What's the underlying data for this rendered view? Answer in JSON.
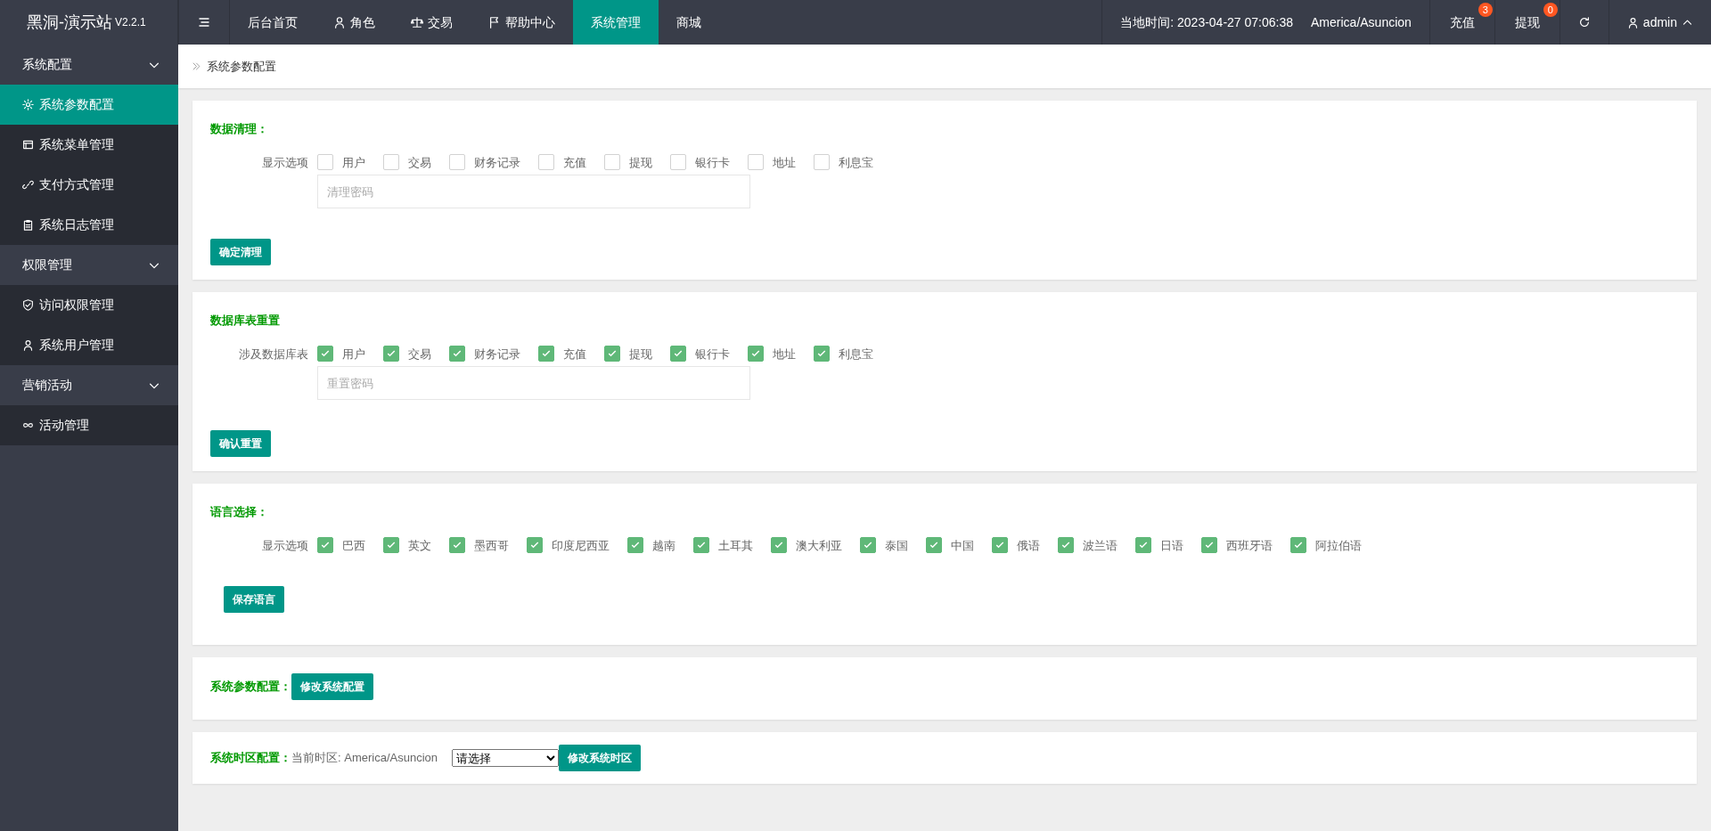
{
  "brand": {
    "name": "黑洞-演示站",
    "version": "V2.2.1"
  },
  "top_nav": [
    {
      "label": "后台首页",
      "selected": false
    },
    {
      "label": "角色",
      "selected": false
    },
    {
      "label": "交易",
      "selected": false
    },
    {
      "label": "帮助中心",
      "selected": false
    },
    {
      "label": "系统管理",
      "selected": true
    },
    {
      "label": "商城",
      "selected": false
    }
  ],
  "top_right": {
    "time": "当地时间: 2023-04-27 07:06:38",
    "timezone": "America/Asuncion",
    "actions": [
      {
        "label": "充值",
        "badge": "3"
      },
      {
        "label": "提现",
        "badge": "0"
      }
    ],
    "user": "admin"
  },
  "sidebar": [
    {
      "label": "系统配置",
      "expanded": true,
      "items": [
        {
          "label": "系统参数配置",
          "selected": true
        },
        {
          "label": "系统菜单管理",
          "selected": false
        },
        {
          "label": "支付方式管理",
          "selected": false
        },
        {
          "label": "系统日志管理",
          "selected": false
        }
      ]
    },
    {
      "label": "权限管理",
      "expanded": true,
      "items": [
        {
          "label": "访问权限管理",
          "selected": false
        },
        {
          "label": "系统用户管理",
          "selected": false
        }
      ]
    },
    {
      "label": "营销活动",
      "expanded": true,
      "items": [
        {
          "label": "活动管理",
          "selected": false
        }
      ]
    }
  ],
  "breadcrumb": "系统参数配置",
  "sections": [
    {
      "kind": "checks",
      "title": "数据清理：",
      "field_label": "显示选项",
      "options": [
        {
          "label": "用户",
          "checked": false
        },
        {
          "label": "交易",
          "checked": false
        },
        {
          "label": "财务记录",
          "checked": false
        },
        {
          "label": "充值",
          "checked": false
        },
        {
          "label": "提现",
          "checked": false
        },
        {
          "label": "银行卡",
          "checked": false
        },
        {
          "label": "地址",
          "checked": false
        },
        {
          "label": "利息宝",
          "checked": false
        }
      ],
      "placeholder": "清理密码",
      "button": "确定清理"
    },
    {
      "kind": "checks",
      "title": "数据库表重置",
      "field_label": "涉及数据库表",
      "options": [
        {
          "label": "用户",
          "checked": true
        },
        {
          "label": "交易",
          "checked": true
        },
        {
          "label": "财务记录",
          "checked": true
        },
        {
          "label": "充值",
          "checked": true
        },
        {
          "label": "提现",
          "checked": true
        },
        {
          "label": "银行卡",
          "checked": true
        },
        {
          "label": "地址",
          "checked": true
        },
        {
          "label": "利息宝",
          "checked": true
        }
      ],
      "placeholder": "重置密码",
      "button": "确认重置"
    },
    {
      "kind": "checks",
      "title": "语言选择：",
      "field_label": "显示选项",
      "options": [
        {
          "label": "巴西",
          "checked": true
        },
        {
          "label": "英文",
          "checked": true
        },
        {
          "label": "墨西哥",
          "checked": true
        },
        {
          "label": "印度尼西亚",
          "checked": true
        },
        {
          "label": "越南",
          "checked": true
        },
        {
          "label": "土耳其",
          "checked": true
        },
        {
          "label": "澳大利亚",
          "checked": true
        },
        {
          "label": "泰国",
          "checked": true
        },
        {
          "label": "中国",
          "checked": true
        },
        {
          "label": "俄语",
          "checked": true
        },
        {
          "label": "波兰语",
          "checked": true
        },
        {
          "label": "日语",
          "checked": true
        },
        {
          "label": "西班牙语",
          "checked": true
        },
        {
          "label": "阿拉伯语",
          "checked": true
        }
      ],
      "button": "保存语言"
    },
    {
      "kind": "inline",
      "title": "系统参数配置：",
      "button": "修改系统配置"
    },
    {
      "kind": "timezone",
      "title": "系统时区配置：",
      "current": "当前时区: America/Asuncion",
      "select": "请选择",
      "button": "修改系统时区"
    }
  ]
}
